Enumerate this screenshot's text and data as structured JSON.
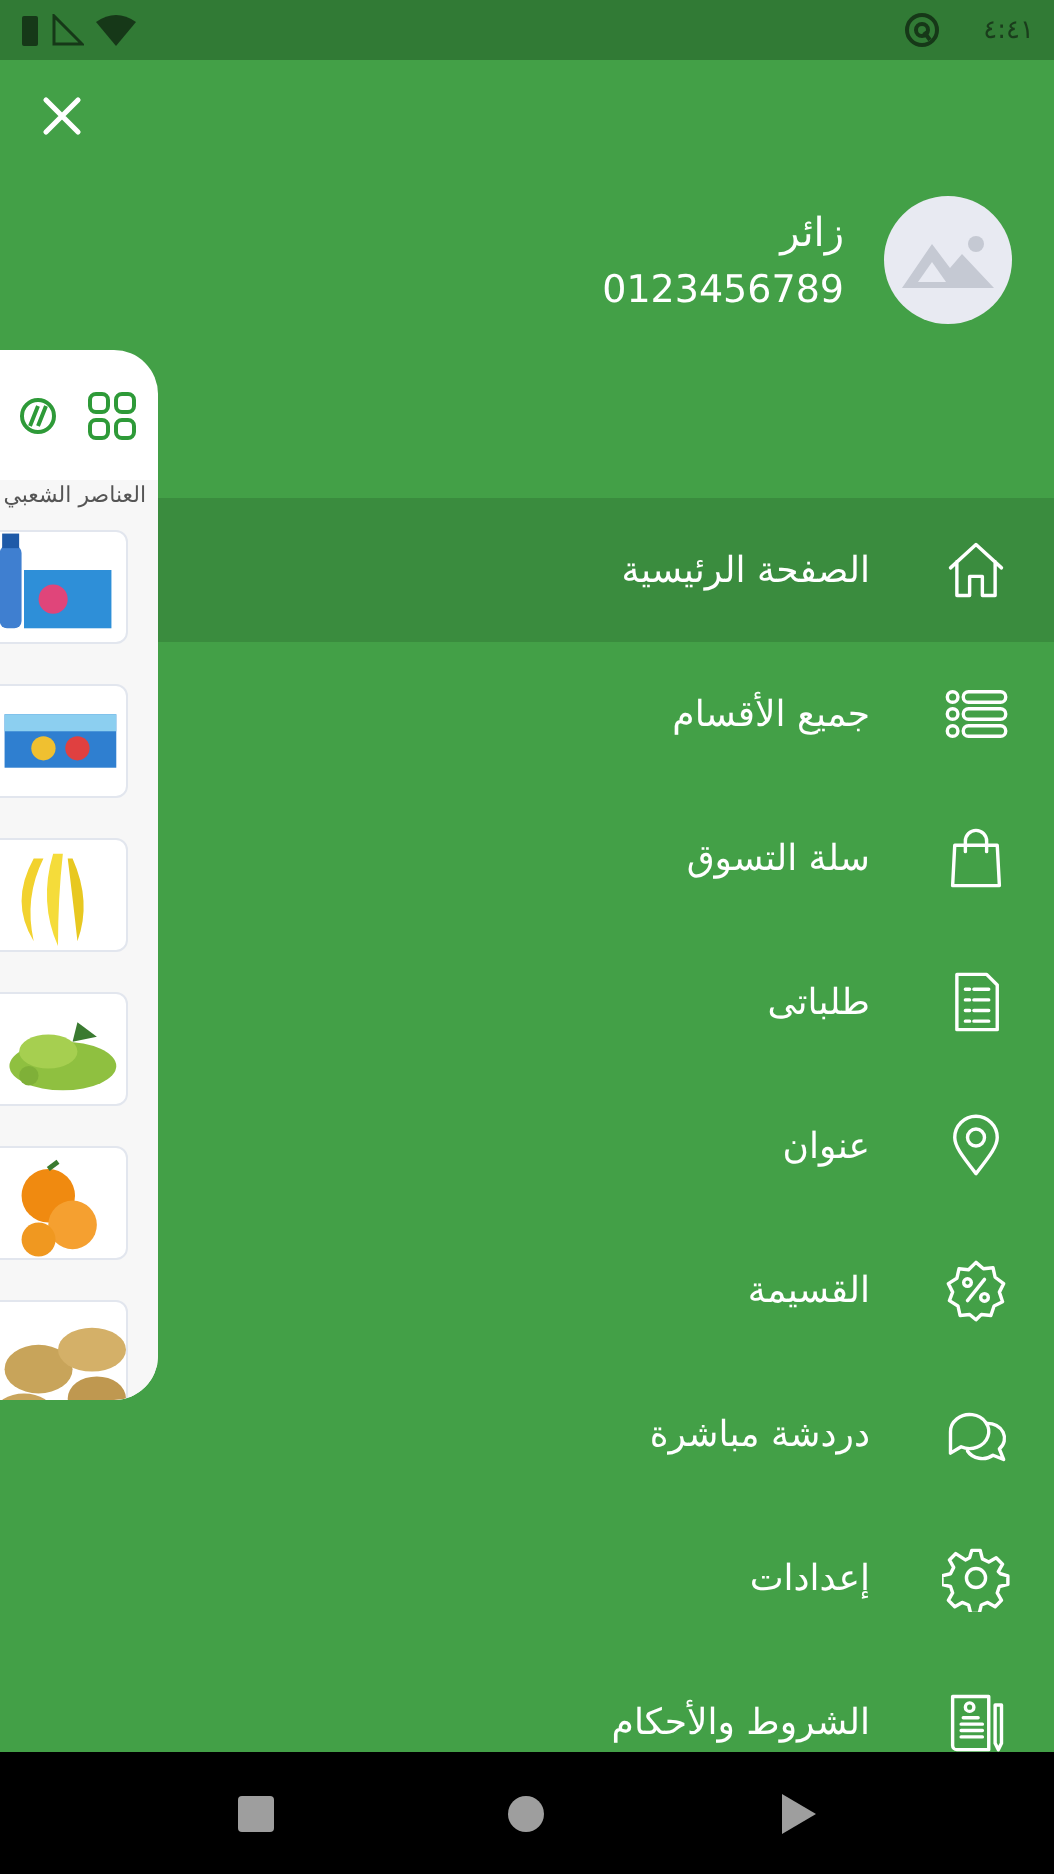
{
  "status_bar": {
    "time": "٤:٤١"
  },
  "drawer": {
    "user": {
      "name": "زائر",
      "phone": "0123456789"
    },
    "menu": [
      {
        "label": "الصفحة الرئيسية",
        "selected": true
      },
      {
        "label": "جميع الأقسام",
        "selected": false
      },
      {
        "label": "سلة التسوق",
        "selected": false
      },
      {
        "label": "طلباتى",
        "selected": false
      },
      {
        "label": "عنوان",
        "selected": false
      },
      {
        "label": "القسيمة",
        "selected": false
      },
      {
        "label": "دردشة مباشرة",
        "selected": false
      },
      {
        "label": "إعدادات",
        "selected": false
      },
      {
        "label": "الشروط والأحكام",
        "selected": false
      }
    ]
  },
  "preview": {
    "section_title": "العناصر الشعبي"
  }
}
